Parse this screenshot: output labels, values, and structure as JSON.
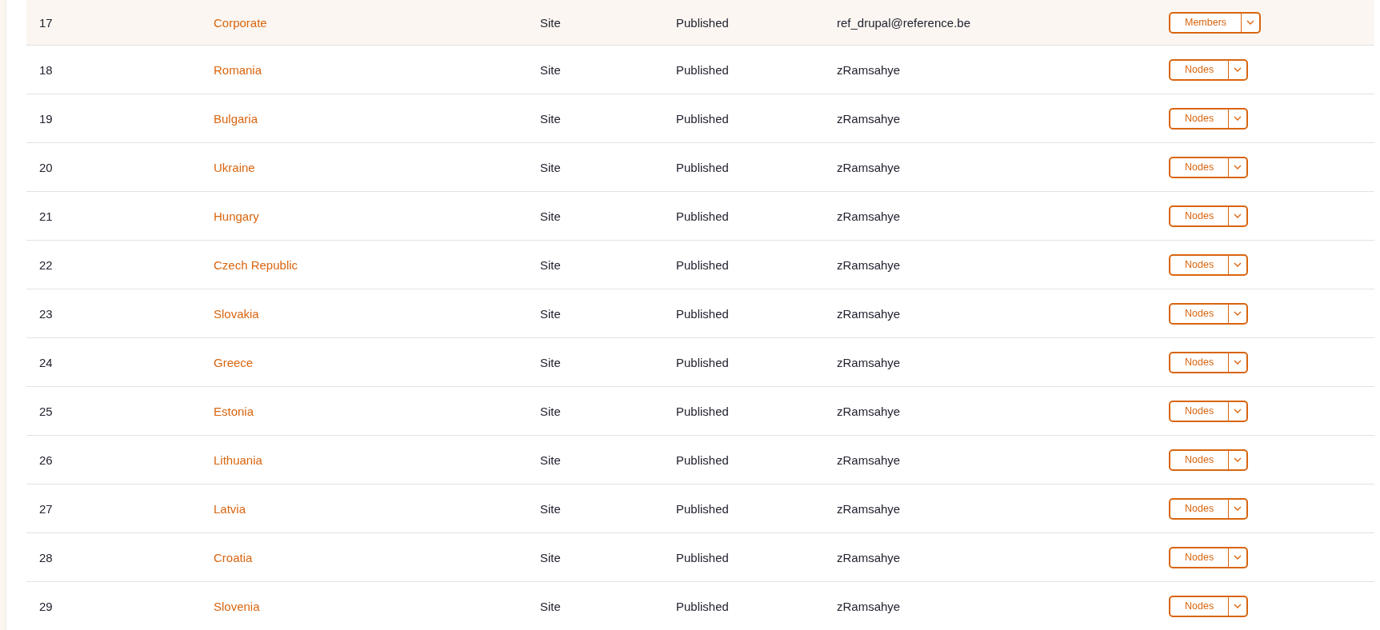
{
  "rows": [
    {
      "id": "17",
      "name": "Corporate",
      "type": "Site",
      "status": "Published",
      "author": "ref_drupal@reference.be",
      "action": "Members",
      "highlighted": true
    },
    {
      "id": "18",
      "name": "Romania",
      "type": "Site",
      "status": "Published",
      "author": "zRamsahye",
      "action": "Nodes",
      "highlighted": false
    },
    {
      "id": "19",
      "name": "Bulgaria",
      "type": "Site",
      "status": "Published",
      "author": "zRamsahye",
      "action": "Nodes",
      "highlighted": false
    },
    {
      "id": "20",
      "name": "Ukraine",
      "type": "Site",
      "status": "Published",
      "author": "zRamsahye",
      "action": "Nodes",
      "highlighted": false
    },
    {
      "id": "21",
      "name": "Hungary",
      "type": "Site",
      "status": "Published",
      "author": "zRamsahye",
      "action": "Nodes",
      "highlighted": false
    },
    {
      "id": "22",
      "name": "Czech Republic",
      "type": "Site",
      "status": "Published",
      "author": "zRamsahye",
      "action": "Nodes",
      "highlighted": false
    },
    {
      "id": "23",
      "name": "Slovakia",
      "type": "Site",
      "status": "Published",
      "author": "zRamsahye",
      "action": "Nodes",
      "highlighted": false
    },
    {
      "id": "24",
      "name": "Greece",
      "type": "Site",
      "status": "Published",
      "author": "zRamsahye",
      "action": "Nodes",
      "highlighted": false
    },
    {
      "id": "25",
      "name": "Estonia",
      "type": "Site",
      "status": "Published",
      "author": "zRamsahye",
      "action": "Nodes",
      "highlighted": false
    },
    {
      "id": "26",
      "name": "Lithuania",
      "type": "Site",
      "status": "Published",
      "author": "zRamsahye",
      "action": "Nodes",
      "highlighted": false
    },
    {
      "id": "27",
      "name": "Latvia",
      "type": "Site",
      "status": "Published",
      "author": "zRamsahye",
      "action": "Nodes",
      "highlighted": false
    },
    {
      "id": "28",
      "name": "Croatia",
      "type": "Site",
      "status": "Published",
      "author": "zRamsahye",
      "action": "Nodes",
      "highlighted": false
    },
    {
      "id": "29",
      "name": "Slovenia",
      "type": "Site",
      "status": "Published",
      "author": "zRamsahye",
      "action": "Nodes",
      "highlighted": false
    }
  ]
}
